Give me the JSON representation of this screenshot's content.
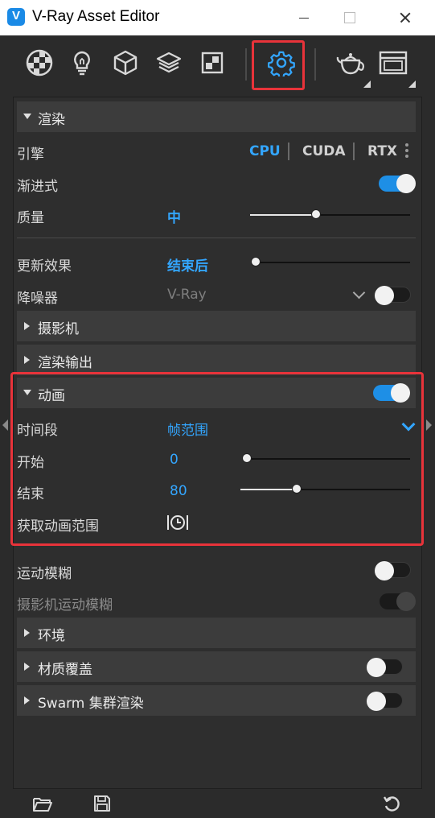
{
  "window": {
    "title": "V-Ray Asset Editor"
  },
  "toolbar": {
    "buttons": [
      {
        "icon": "materials-icon"
      },
      {
        "icon": "lights-icon"
      },
      {
        "icon": "geometry-icon"
      },
      {
        "icon": "layers-icon"
      },
      {
        "icon": "textures-icon"
      },
      {
        "icon": "settings-icon",
        "active": true
      },
      {
        "icon": "render-teapot-icon"
      },
      {
        "icon": "frame-buffer-icon"
      }
    ],
    "accent": "#33a6ff",
    "highlight": "#e8333a"
  },
  "render": {
    "header": "渲染",
    "engine_label": "引擎",
    "engines": [
      "CPU",
      "CUDA",
      "RTX"
    ],
    "selected_engine": "CPU",
    "progressive_label": "渐进式",
    "progressive_on": true,
    "quality_label": "质量",
    "quality_value": "中",
    "update_effects_label": "更新效果",
    "update_effects_value": "结束后",
    "denoiser_label": "降噪器",
    "denoiser_value": "V-Ray",
    "denoiser_on": false
  },
  "camera": {
    "header": "摄影机"
  },
  "render_output": {
    "header": "渲染输出"
  },
  "animation": {
    "header": "动画",
    "enabled": true,
    "time_segment_label": "时间段",
    "time_segment_value": "帧范围",
    "start_label": "开始",
    "start_value": "0",
    "end_label": "结束",
    "end_value": "80",
    "get_range_label": "获取动画范围"
  },
  "motion_blur": {
    "label": "运动模糊",
    "on": false
  },
  "camera_motion_blur": {
    "label": "摄影机运动模糊",
    "enabled": false
  },
  "environment": {
    "header": "环境"
  },
  "material_override": {
    "header": "材质覆盖",
    "on": false
  },
  "swarm": {
    "header": "Swarm 集群渲染",
    "on": false
  },
  "bottom": {
    "buttons": [
      "open-folder-icon",
      "save-icon",
      "reset-icon"
    ]
  }
}
